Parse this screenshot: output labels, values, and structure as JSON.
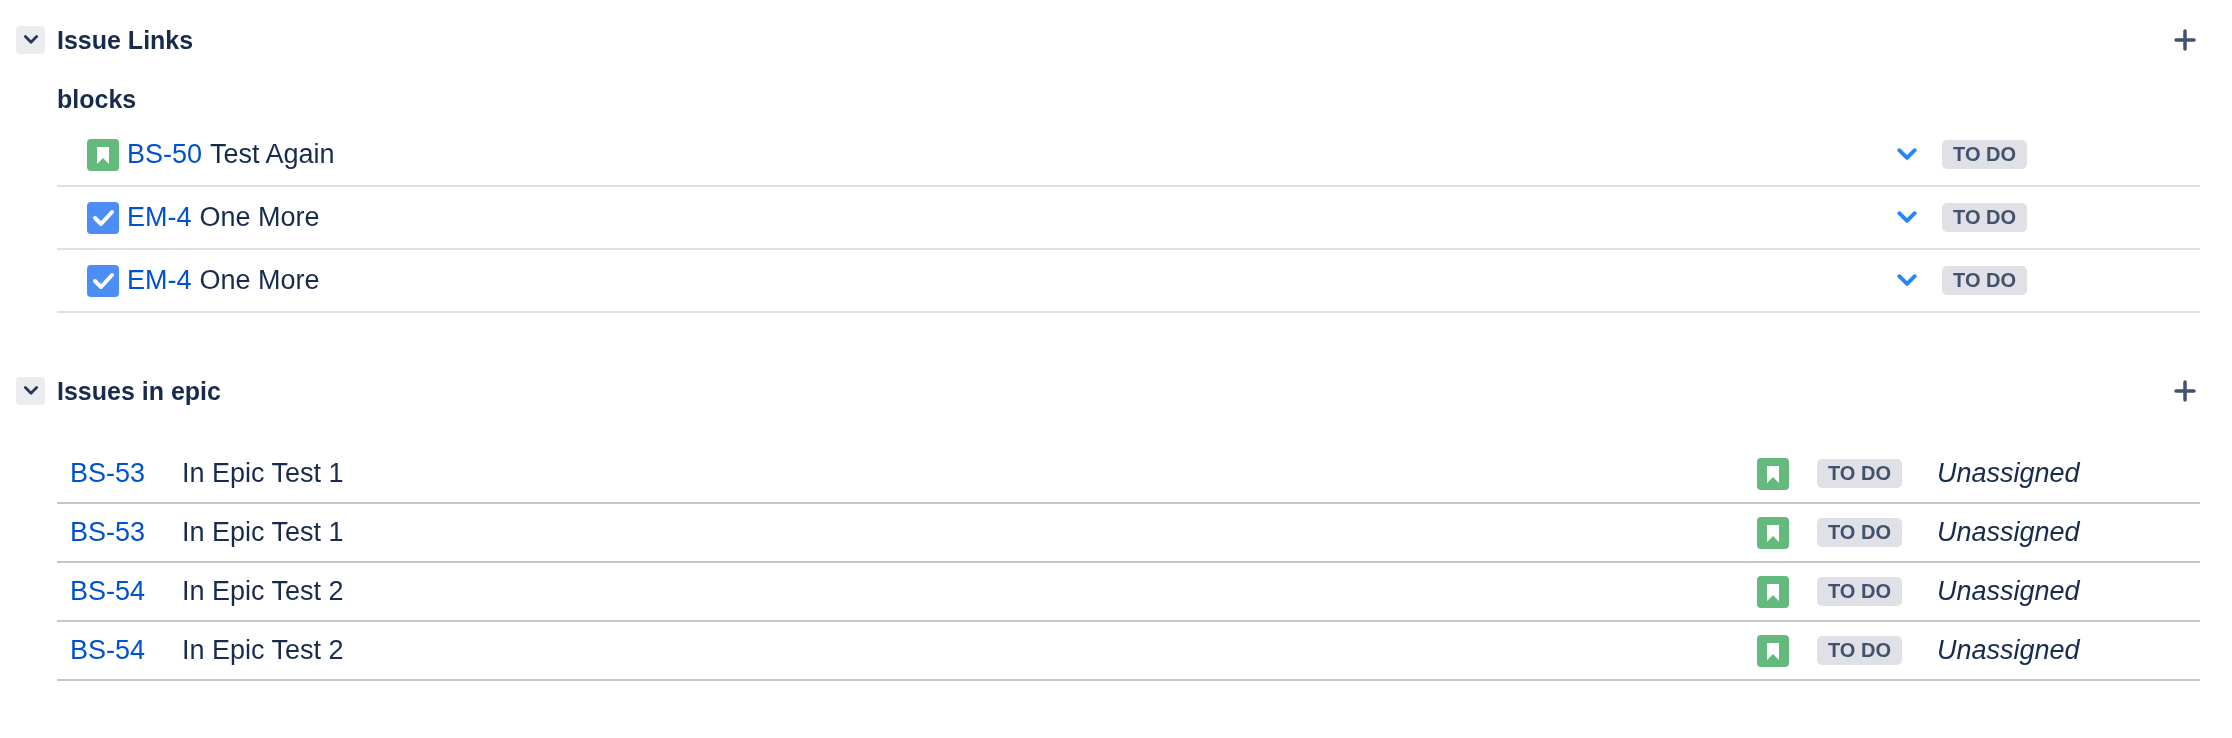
{
  "sections": [
    {
      "kind": "links",
      "title": "Issue Links",
      "expanded": true,
      "groups": [
        {
          "label": "blocks",
          "issues": [
            {
              "kind": "story",
              "key": "BS-50",
              "summary": "Test Again",
              "status": "TO DO"
            },
            {
              "kind": "task",
              "key": "EM-4",
              "summary": "One More",
              "status": "TO DO"
            },
            {
              "kind": "task",
              "key": "EM-4",
              "summary": "One More",
              "status": "TO DO"
            }
          ]
        }
      ]
    },
    {
      "kind": "epic",
      "title": "Issues in epic",
      "expanded": true,
      "issues": [
        {
          "kind": "story",
          "key": "BS-53",
          "summary": "In Epic Test 1",
          "status": "TO DO",
          "assignee": "Unassigned"
        },
        {
          "kind": "story",
          "key": "BS-53",
          "summary": "In Epic Test 1",
          "status": "TO DO",
          "assignee": "Unassigned"
        },
        {
          "kind": "story",
          "key": "BS-54",
          "summary": "In Epic Test 2",
          "status": "TO DO",
          "assignee": "Unassigned"
        },
        {
          "kind": "story",
          "key": "BS-54",
          "summary": "In Epic Test 2",
          "status": "TO DO",
          "assignee": "Unassigned"
        }
      ]
    }
  ]
}
